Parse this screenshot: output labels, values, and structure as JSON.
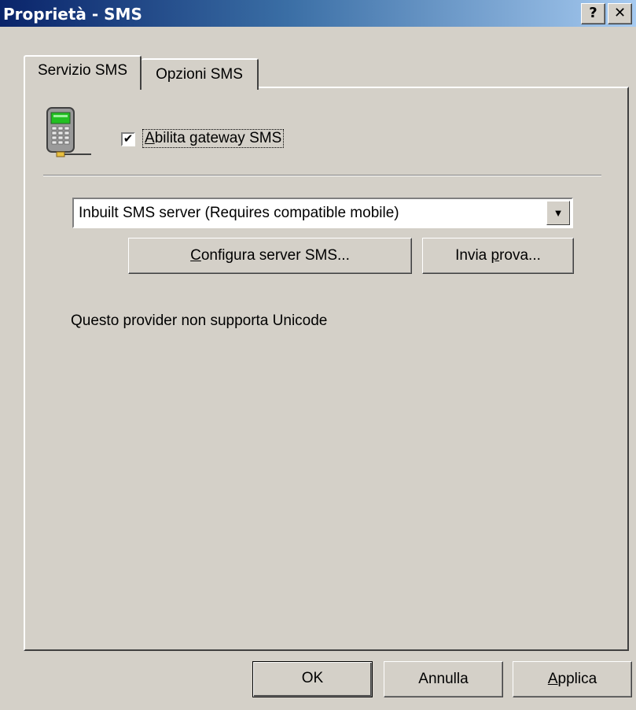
{
  "window": {
    "title": "Proprietà - SMS",
    "help_label": "?",
    "close_label": "✕"
  },
  "tabs": [
    {
      "label": "Servizio SMS",
      "active": true
    },
    {
      "label": "Opzioni SMS",
      "active": false
    }
  ],
  "gateway": {
    "checked": true,
    "check_mark": "✔",
    "label_accel": "A",
    "label_rest": "bilita gateway SMS"
  },
  "provider": {
    "selected": "Inbuilt SMS server (Requires compatible mobile)",
    "arrow": "▼"
  },
  "configure_button": {
    "accel": "C",
    "rest": "onfigura server SMS..."
  },
  "test_button": {
    "pre": "Invia ",
    "accel": "p",
    "rest": "rova..."
  },
  "info_text": "Questo provider non supporta Unicode",
  "footer": {
    "ok": "OK",
    "cancel": "Annulla",
    "apply_accel": "A",
    "apply_rest": "pplica"
  },
  "colors": {
    "face": "#d4d0c8",
    "title_start": "#0a246a",
    "title_end": "#a6caf0"
  },
  "icons": [
    "mobile-phone-icon",
    "help-icon",
    "close-icon",
    "dropdown-arrow-icon"
  ]
}
